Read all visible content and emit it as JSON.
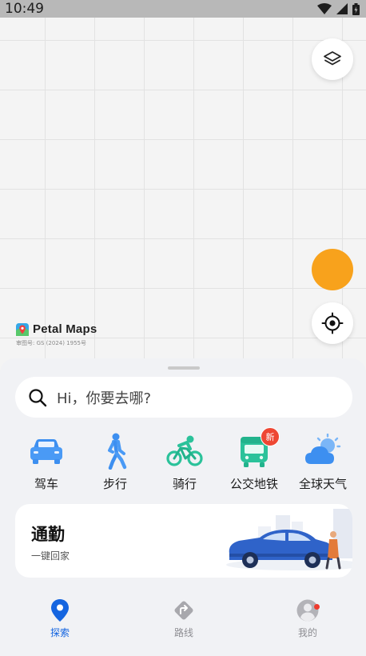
{
  "status": {
    "time": "10:49"
  },
  "map": {
    "brand_name": "Petal Maps",
    "approval_no": "审图号: GS (2024) 1955号"
  },
  "search": {
    "placeholder": "Hi，你要去哪?"
  },
  "modes": [
    {
      "label": "驾车",
      "icon": "car-icon"
    },
    {
      "label": "步行",
      "icon": "walk-icon"
    },
    {
      "label": "骑行",
      "icon": "bike-icon"
    },
    {
      "label": "公交地铁",
      "icon": "bus-icon",
      "badge": "新"
    },
    {
      "label": "全球天气",
      "icon": "weather-icon"
    }
  ],
  "commute": {
    "title": "通勤",
    "subtitle": "一键回家"
  },
  "tabs": [
    {
      "label": "探索",
      "active": true
    },
    {
      "label": "路线",
      "active": false
    },
    {
      "label": "我的",
      "active": false,
      "notification": true
    }
  ],
  "colors": {
    "accent": "#1565e0",
    "orange": "#f8a21c",
    "badge": "#ee4733"
  }
}
